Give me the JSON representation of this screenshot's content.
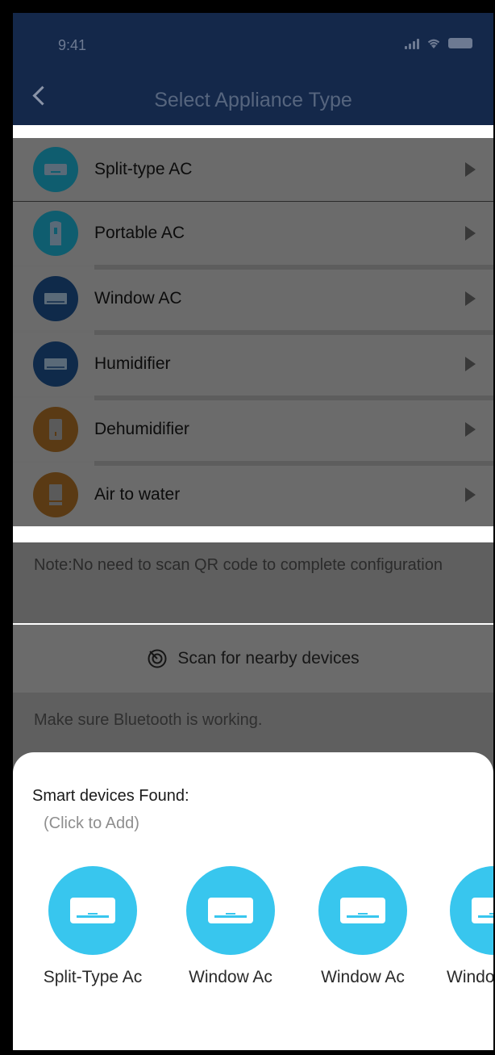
{
  "status": {
    "time": "9:41"
  },
  "header": {
    "title": "Select Appliance Type"
  },
  "appliances": [
    {
      "label": "Split-type AC",
      "icon": "split-ac-icon",
      "color": "#0f5d6f"
    },
    {
      "label": "Portable AC",
      "icon": "portable-ac-icon",
      "color": "#0f5d6f"
    },
    {
      "label": "Window AC",
      "icon": "window-ac-icon",
      "color": "#0f2a4a"
    },
    {
      "label": "Humidifier",
      "icon": "humidifier-icon",
      "color": "#0f2a4a"
    },
    {
      "label": "Dehumidifier",
      "icon": "dehumidifier-icon",
      "color": "#5a3a14"
    },
    {
      "label": "Air to water",
      "icon": "air-to-water-icon",
      "color": "#5a3a14"
    }
  ],
  "note": {
    "text": "Note:No need to scan QR code to complete configuration"
  },
  "scan": {
    "label": "Scan for nearby devices"
  },
  "bluetooth": {
    "text": "Make sure Bluetooth is working."
  },
  "sheet": {
    "title": "Smart devices Found:",
    "subtitle": "(Click to Add)",
    "devices": [
      {
        "label": "Split-Type Ac"
      },
      {
        "label": "Window Ac"
      },
      {
        "label": "Window Ac"
      },
      {
        "label": "Windo"
      }
    ]
  },
  "colors": {
    "accent": "#38c6ee",
    "header": "#14284a"
  }
}
